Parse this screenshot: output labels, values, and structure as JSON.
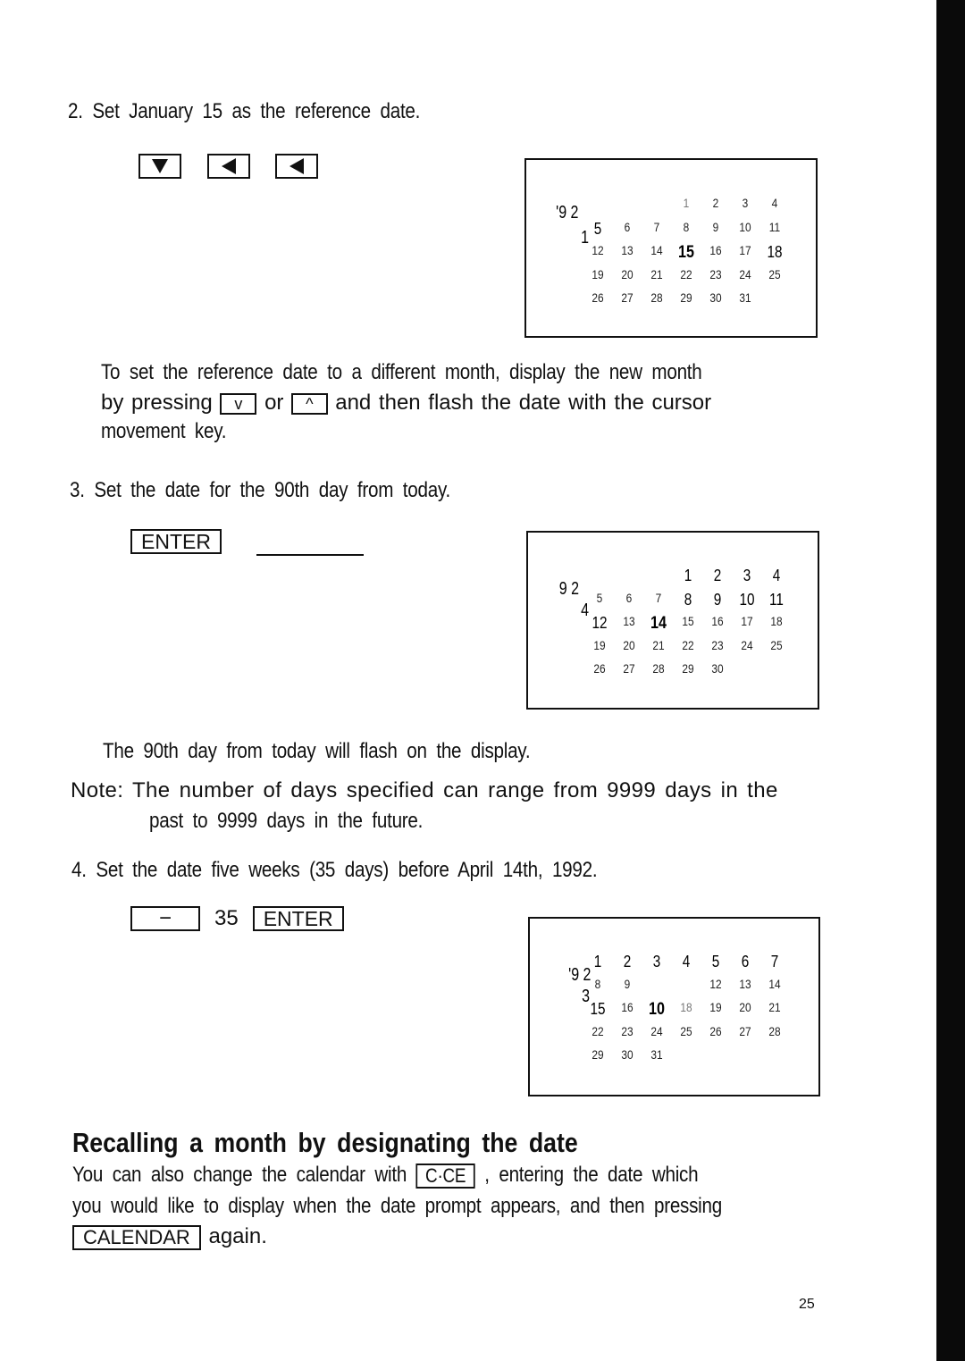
{
  "page": {
    "number": "25"
  },
  "step2": {
    "text": "2.  Set  January  15  as  the  reference  date.",
    "keys": [
      {
        "icon": "down-triangle-icon"
      },
      {
        "icon": "left-triangle-icon"
      },
      {
        "icon": "left-triangle-icon"
      }
    ],
    "display": {
      "year_prefix": "'9 2",
      "month": "1",
      "rows": [
        [
          "",
          "",
          "",
          "1",
          "2",
          "3",
          "4"
        ],
        [
          "5",
          "6",
          "7",
          "8",
          "9",
          "10",
          "11"
        ],
        [
          "12",
          "13",
          "14",
          "15",
          "16",
          "17",
          "18"
        ],
        [
          "19",
          "20",
          "21",
          "22",
          "23",
          "24",
          "25"
        ],
        [
          "26",
          "27",
          "28",
          "29",
          "30",
          "31",
          ""
        ]
      ],
      "flashing_day": "15",
      "bold_days": [
        "5",
        "15",
        "18"
      ]
    }
  },
  "para_reference": {
    "line1": "To  set  the  reference  date  to  a  different  month,  display  the  new  month",
    "line2_pre": "by pressing",
    "key_down": "v",
    "line2_or": "or",
    "key_up": "^",
    "line2_post": "and then flash the date with the cursor",
    "line3": "movement  key."
  },
  "step3": {
    "text": "3.  Set  the  date  for  the  90th  day  from  today.",
    "key_enter": "ENTER",
    "display": {
      "year_prefix": "9 2",
      "month": "4",
      "rows": [
        [
          "",
          "",
          "",
          "1",
          "2",
          "3",
          "4"
        ],
        [
          "5",
          "6",
          "7",
          "8",
          "9",
          "10",
          "11"
        ],
        [
          "12",
          "13",
          "14",
          "15",
          "16",
          "17",
          "18"
        ],
        [
          "19",
          "20",
          "21",
          "22",
          "23",
          "24",
          "25"
        ],
        [
          "26",
          "27",
          "28",
          "29",
          "30",
          "",
          ""
        ]
      ],
      "flashing_day": "14"
    },
    "result_text": "The  90th  day  from  today  will  flash  on  the  display."
  },
  "note": {
    "line1": "Note: The number of days specified can range from 9999 days in the",
    "line2": "past  to  9999  days  in  the  future."
  },
  "step4": {
    "text": "4.  Set  the  date  five  weeks  (35  days)  before  April  14th,  1992.",
    "key_minus": "−",
    "number": "35",
    "key_enter": "ENTER",
    "display": {
      "year_prefix": "'9 2",
      "month": "3",
      "rows": [
        [
          "1",
          "2",
          "3",
          "4",
          "5",
          "6",
          "7"
        ],
        [
          "8",
          "9",
          "",
          "",
          "12",
          "13",
          "14"
        ],
        [
          "15",
          "16",
          "10",
          "18",
          "19",
          "20",
          "21"
        ],
        [
          "22",
          "23",
          "24",
          "25",
          "26",
          "27",
          "28"
        ],
        [
          "29",
          "30",
          "31",
          "",
          "",
          "",
          ""
        ]
      ],
      "flashing_day": "10"
    }
  },
  "section": {
    "heading": "Recalling  a  month  by  designating  the  date",
    "p1_pre": "You  can  also  change  the  calendar  with",
    "key_cce": "C·CE",
    "p1_post": ",  entering  the  date  which",
    "p2": "you  would  like  to  display  when  the  date  prompt  appears,  and  then  pressing",
    "key_calendar": "CALENDAR",
    "p3_post": "again."
  }
}
